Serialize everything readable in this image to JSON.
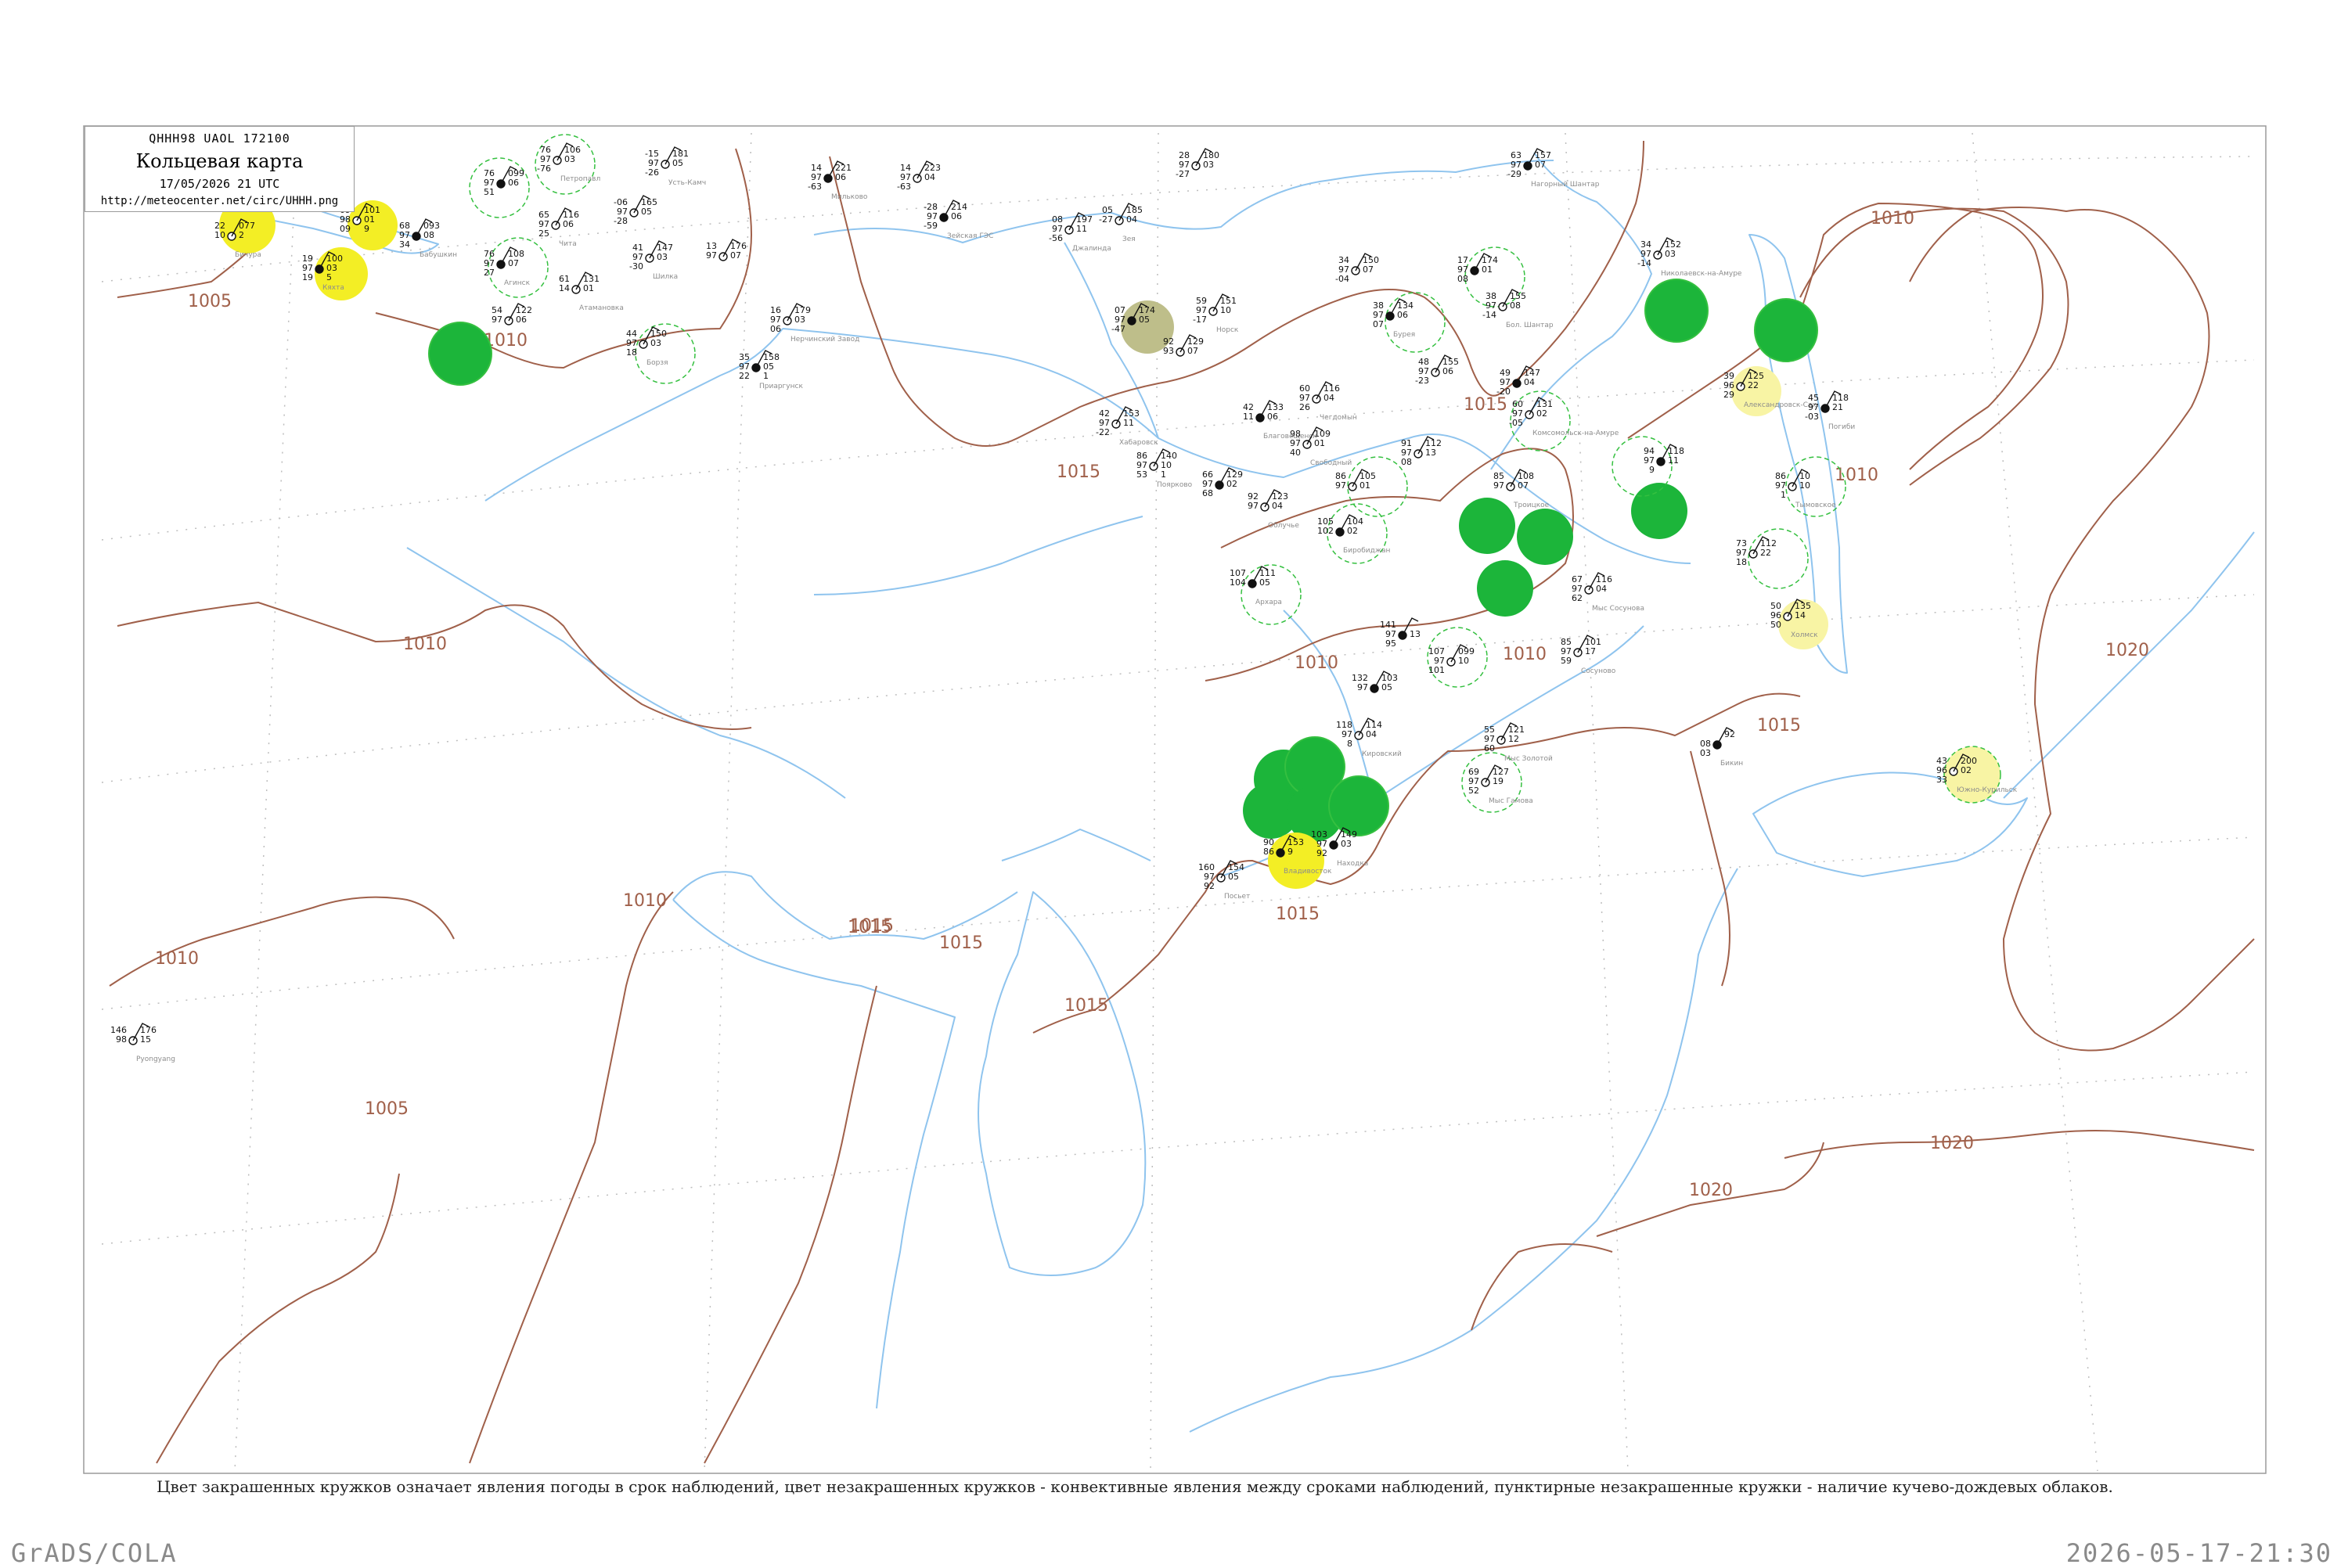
{
  "header": {
    "code": "QHHH98 UAOL 172100",
    "title": "Кольцевая карта",
    "datetime": "17/05/2026 21 UTC",
    "url": "http://meteocenter.net/circ/UHHH.png"
  },
  "caption": "Цвет закрашенных кружков означает явления погоды в срок наблюдений, цвет незакрашенных кружков - конвективные явления между сроками наблюдений, пунктирные незакрашенные кружки - наличие кучево-дождевых облаков.",
  "footer": {
    "left": "GrADS/COLA",
    "right": "2026-05-17-21:30"
  },
  "colors": {
    "isobar": "#a0604a",
    "coast": "#8fc4ee",
    "green_fill": "#1cb53a",
    "yellow_fill": "#f3ee25",
    "pale_yellow_fill": "#f8f4a4",
    "olive_fill": "#bebe8a",
    "dashed_ring": "#35c040"
  },
  "isobar_labels": [
    "1005",
    "1010",
    "1015",
    "1010",
    "1010",
    "1015",
    "1015",
    "1010",
    "1015",
    "1010",
    "1010",
    "1015",
    "1010",
    "1020",
    "1015",
    "1010",
    "1015",
    "1015",
    "1005",
    "1020",
    "1020"
  ],
  "stations": [
    {
      "id": "s1",
      "lines": [
        "76",
        "97",
        "51"
      ],
      "right": [
        "099",
        "06"
      ],
      "name": ""
    },
    {
      "id": "s2",
      "lines": [
        "76",
        "97",
        "-76"
      ],
      "right": [
        "106",
        "03"
      ],
      "name": "Петропавл"
    },
    {
      "id": "s3",
      "lines": [
        "-15",
        "97",
        "-26"
      ],
      "right": [
        "181",
        "05"
      ],
      "name": "Усть-Камч"
    },
    {
      "id": "s4",
      "lines": [
        "14",
        "97",
        "-63"
      ],
      "right": [
        "221",
        "06"
      ],
      "name": "Мильково"
    },
    {
      "id": "s5",
      "lines": [
        "14",
        "97",
        "-63"
      ],
      "right": [
        "223",
        "04"
      ],
      "name": ""
    },
    {
      "id": "s6",
      "lines": [
        "28",
        "97",
        "-27"
      ],
      "right": [
        "180",
        "03"
      ],
      "name": ""
    },
    {
      "id": "s7",
      "lines": [
        "63",
        "97",
        "-29"
      ],
      "right": [
        "157",
        "07"
      ],
      "name": "Нагорный Шантар"
    },
    {
      "id": "s8",
      "lines": [
        "22",
        "10"
      ],
      "right": [
        "077",
        "2"
      ],
      "name": "Бичура"
    },
    {
      "id": "s9",
      "lines": [
        "09",
        "98",
        "09"
      ],
      "right": [
        "101",
        "01",
        "9"
      ],
      "name": ""
    },
    {
      "id": "s10",
      "lines": [
        "68",
        "97",
        "34"
      ],
      "right": [
        "093",
        "08"
      ],
      "name": "Бабушкин"
    },
    {
      "id": "s11",
      "lines": [
        "-06",
        "97",
        "-28"
      ],
      "right": [
        "165",
        "05"
      ],
      "name": ""
    },
    {
      "id": "s12",
      "lines": [
        "65",
        "97",
        "25"
      ],
      "right": [
        "116",
        "06"
      ],
      "name": "Чита"
    },
    {
      "id": "s13",
      "lines": [
        "76",
        "97",
        "27"
      ],
      "right": [
        "108",
        "07"
      ],
      "name": "Агинск"
    },
    {
      "id": "s14",
      "lines": [
        "41",
        "97",
        "-30"
      ],
      "right": [
        "147",
        "03"
      ],
      "name": "Шилка"
    },
    {
      "id": "s15",
      "lines": [
        "13",
        "97"
      ],
      "right": [
        "176",
        "07"
      ],
      "name": ""
    },
    {
      "id": "s16",
      "lines": [
        "-28",
        "97",
        "-59"
      ],
      "right": [
        "214",
        "06"
      ],
      "name": "Зейская ГЭС"
    },
    {
      "id": "s17",
      "lines": [
        "08",
        "97",
        "-56"
      ],
      "right": [
        "197",
        "11"
      ],
      "name": "Джалинда"
    },
    {
      "id": "s18",
      "lines": [
        "05",
        "-27"
      ],
      "right": [
        "185",
        "04"
      ],
      "name": "Зея"
    },
    {
      "id": "s19",
      "lines": [
        "19",
        "97",
        "19"
      ],
      "right": [
        "100",
        "03",
        "5"
      ],
      "name": "Кяхта"
    },
    {
      "id": "s20",
      "lines": [
        "61",
        "14"
      ],
      "right": [
        "131",
        "01"
      ],
      "name": "Атамановка"
    },
    {
      "id": "s21",
      "lines": [
        "34",
        "97",
        "-04"
      ],
      "right": [
        "150",
        "07"
      ],
      "name": ""
    },
    {
      "id": "s22",
      "lines": [
        "17",
        "97",
        "08"
      ],
      "right": [
        "174",
        "01"
      ],
      "name": ""
    },
    {
      "id": "s23",
      "lines": [
        "34",
        "97",
        "-14"
      ],
      "right": [
        "152",
        "03"
      ],
      "name": "Николаевск-на-Амуре"
    },
    {
      "id": "s24",
      "lines": [
        "59",
        "97",
        "-17"
      ],
      "right": [
        "151",
        "10"
      ],
      "name": "Норск"
    },
    {
      "id": "s25",
      "lines": [
        "07",
        "97",
        "-47"
      ],
      "right": [
        "174",
        "05"
      ],
      "name": ""
    },
    {
      "id": "s26",
      "lines": [
        "92",
        "93"
      ],
      "right": [
        "129",
        "07"
      ],
      "name": ""
    },
    {
      "id": "s27",
      "lines": [
        "16",
        "97",
        "06"
      ],
      "right": [
        "179",
        "03"
      ],
      "name": "Нерчинский Завод"
    },
    {
      "id": "s28",
      "lines": [
        "35",
        "97",
        "22"
      ],
      "right": [
        "158",
        "05",
        "1"
      ],
      "name": "Приаргунск"
    },
    {
      "id": "s29",
      "lines": [
        "44",
        "97",
        "18"
      ],
      "right": [
        "150",
        "03"
      ],
      "name": "Борзя"
    },
    {
      "id": "s30",
      "lines": [
        "54",
        "97"
      ],
      "right": [
        "122",
        "06"
      ],
      "name": ""
    },
    {
      "id": "s31",
      "lines": [
        "38",
        "97",
        "07"
      ],
      "right": [
        "134",
        "06"
      ],
      "name": "Бурея"
    },
    {
      "id": "s32",
      "lines": [
        "48",
        "97",
        "-23"
      ],
      "right": [
        "155",
        "06"
      ],
      "name": ""
    },
    {
      "id": "s33",
      "lines": [
        "38",
        "97",
        "-14"
      ],
      "right": [
        "155",
        "08"
      ],
      "name": "Бол. Шантар"
    },
    {
      "id": "s34",
      "lines": [
        "49",
        "97",
        "-20"
      ],
      "right": [
        "147",
        "04"
      ],
      "name": ""
    },
    {
      "id": "s35",
      "lines": [
        "60",
        "97",
        "-05"
      ],
      "right": [
        "131",
        "02"
      ],
      "name": "Комсомольск-на-Амуре"
    },
    {
      "id": "s36",
      "lines": [
        "39",
        "96",
        "29"
      ],
      "right": [
        "125",
        "22"
      ],
      "name": "Александровск-Сах."
    },
    {
      "id": "s37",
      "lines": [
        "45",
        "97",
        "-03"
      ],
      "right": [
        "118",
        "21"
      ],
      "name": "Погиби"
    },
    {
      "id": "s38",
      "lines": [
        "42",
        "97",
        "-22"
      ],
      "right": [
        "153",
        "11"
      ],
      "name": "Хабаровск"
    },
    {
      "id": "s39",
      "lines": [
        "60",
        "97",
        "26"
      ],
      "right": [
        "116",
        "04"
      ],
      "name": "Чегдомын"
    },
    {
      "id": "s40",
      "lines": [
        "42",
        "11"
      ],
      "right": [
        "133",
        "06"
      ],
      "name": "Благовещенск"
    },
    {
      "id": "s41",
      "lines": [
        "98",
        "97",
        "40"
      ],
      "right": [
        "109",
        "01"
      ],
      "name": "Свободный"
    },
    {
      "id": "s42",
      "lines": [
        "86",
        "97",
        "53"
      ],
      "right": [
        "140",
        "10",
        "1"
      ],
      "name": "Поярково"
    },
    {
      "id": "s43",
      "lines": [
        "66",
        "97",
        "68"
      ],
      "right": [
        "129",
        "02"
      ],
      "name": ""
    },
    {
      "id": "s44",
      "lines": [
        "92",
        "97"
      ],
      "right": [
        "123",
        "04"
      ],
      "name": "Облучье"
    },
    {
      "id": "s45",
      "lines": [
        "86",
        "97"
      ],
      "right": [
        "105",
        "01"
      ],
      "name": ""
    },
    {
      "id": "s46",
      "lines": [
        "105",
        "102"
      ],
      "right": [
        "104",
        "02"
      ],
      "name": "Биробиджан"
    },
    {
      "id": "s47",
      "lines": [
        "91",
        "97",
        "08"
      ],
      "right": [
        "112",
        "13"
      ],
      "name": ""
    },
    {
      "id": "s48",
      "lines": [
        "85",
        "97"
      ],
      "right": [
        "108",
        "07"
      ],
      "name": "Троицкое"
    },
    {
      "id": "s49",
      "lines": [
        "94",
        "97",
        "9"
      ],
      "right": [
        "118",
        "11"
      ],
      "name": ""
    },
    {
      "id": "s50",
      "lines": [
        "73",
        "97",
        "18"
      ],
      "right": [
        "112",
        "22"
      ],
      "name": ""
    },
    {
      "id": "s51",
      "lines": [
        "86",
        "97",
        "1"
      ],
      "right": [
        "10",
        "10"
      ],
      "name": "Тымовское"
    },
    {
      "id": "s52",
      "lines": [
        "107",
        "104"
      ],
      "right": [
        "111",
        "05"
      ],
      "name": "Архара"
    },
    {
      "id": "s53",
      "lines": [
        "67",
        "97",
        "62"
      ],
      "right": [
        "116",
        "04"
      ],
      "name": "Мыс Сосунова"
    },
    {
      "id": "s54",
      "lines": [
        "50",
        "96",
        "50"
      ],
      "right": [
        "135",
        "14"
      ],
      "name": "Холмск"
    },
    {
      "id": "s55",
      "lines": [
        "141",
        "97",
        "95"
      ],
      "right": [
        "",
        "13"
      ],
      "name": ""
    },
    {
      "id": "s56",
      "lines": [
        "107",
        "97",
        "101"
      ],
      "right": [
        "099",
        "10"
      ],
      "name": ""
    },
    {
      "id": "s57",
      "lines": [
        "85",
        "97",
        "59"
      ],
      "right": [
        "101",
        "17"
      ],
      "name": "Сосуново"
    },
    {
      "id": "s58",
      "lines": [
        "132",
        "97"
      ],
      "right": [
        "103",
        "05"
      ],
      "name": ""
    },
    {
      "id": "s59",
      "lines": [
        "118",
        "97",
        "8"
      ],
      "right": [
        "114",
        "04"
      ],
      "name": "Кировский"
    },
    {
      "id": "s60",
      "lines": [
        "55",
        "97",
        "60"
      ],
      "right": [
        "121",
        "12"
      ],
      "name": "Мыс Золотой"
    },
    {
      "id": "s61",
      "lines": [
        "",
        "08",
        "03"
      ],
      "right": [
        "92"
      ],
      "name": "Бикин"
    },
    {
      "id": "s62",
      "lines": [
        "69",
        "97",
        "52"
      ],
      "right": [
        "127",
        "19"
      ],
      "name": "Мыс Гамова"
    },
    {
      "id": "s63",
      "lines": [
        "43",
        "96",
        "33"
      ],
      "right": [
        "200",
        "02"
      ],
      "name": "Южно-Курильск"
    },
    {
      "id": "s64",
      "lines": [
        "103",
        "97",
        "92"
      ],
      "right": [
        "149",
        "03"
      ],
      "name": "Находка"
    },
    {
      "id": "s65",
      "lines": [
        "160",
        "97",
        "92"
      ],
      "right": [
        "154",
        "05"
      ],
      "name": "Посьет"
    },
    {
      "id": "s66",
      "lines": [
        "146",
        "98"
      ],
      "right": [
        "176",
        "15"
      ],
      "name": "Pyongyang"
    },
    {
      "id": "s67",
      "lines": [
        "90",
        "86"
      ],
      "right": [
        "153",
        "9"
      ],
      "name": "Владивосток"
    }
  ]
}
